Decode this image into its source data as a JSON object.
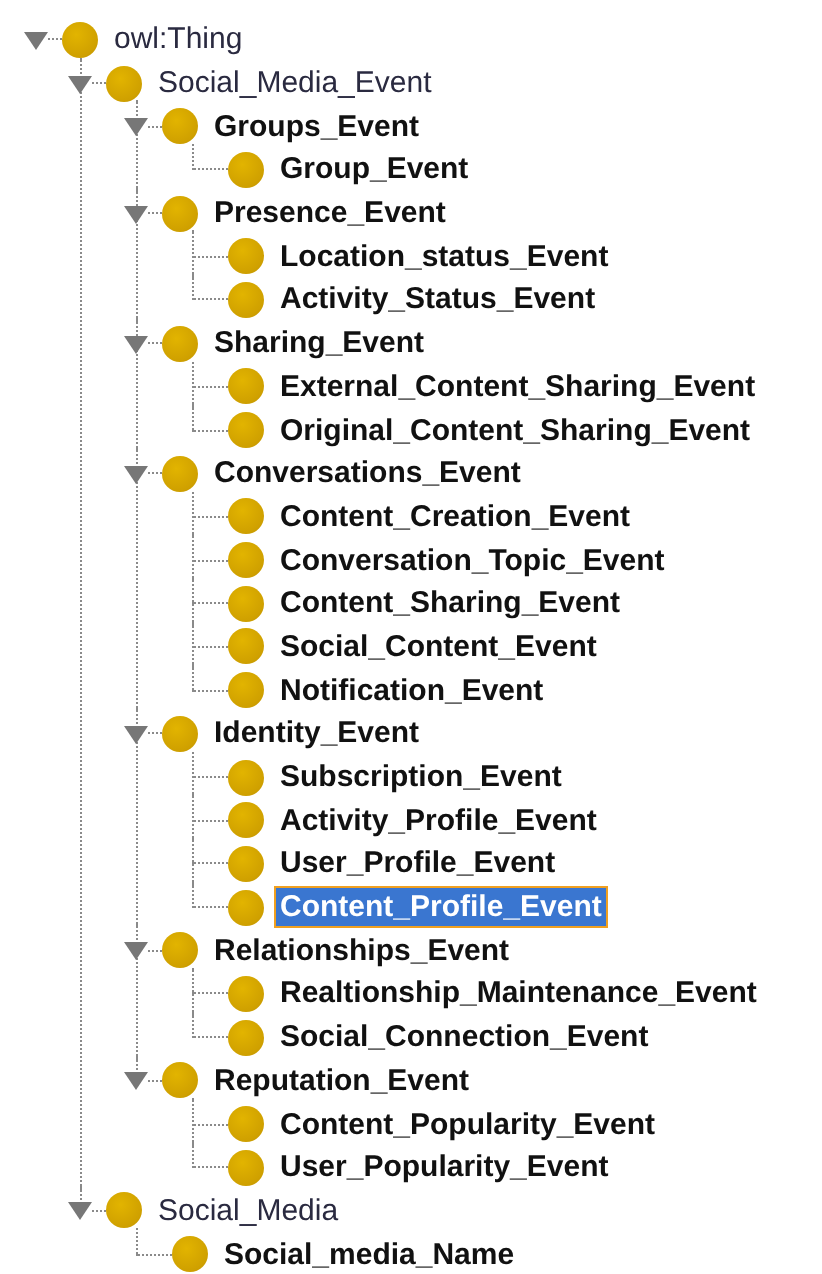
{
  "tree": [
    {
      "label": "owl:Thing",
      "bold": false,
      "selected": false,
      "expanded": true,
      "children": [
        {
          "label": "Social_Media_Event",
          "bold": false,
          "selected": false,
          "expanded": true,
          "children": [
            {
              "label": "Groups_Event",
              "bold": true,
              "selected": false,
              "expanded": true,
              "children": [
                {
                  "label": "Group_Event",
                  "bold": true,
                  "selected": false
                }
              ]
            },
            {
              "label": "Presence_Event",
              "bold": true,
              "selected": false,
              "expanded": true,
              "children": [
                {
                  "label": "Location_status_Event",
                  "bold": true,
                  "selected": false
                },
                {
                  "label": "Activity_Status_Event",
                  "bold": true,
                  "selected": false
                }
              ]
            },
            {
              "label": "Sharing_Event",
              "bold": true,
              "selected": false,
              "expanded": true,
              "children": [
                {
                  "label": "External_Content_Sharing_Event",
                  "bold": true,
                  "selected": false
                },
                {
                  "label": "Original_Content_Sharing_Event",
                  "bold": true,
                  "selected": false
                }
              ]
            },
            {
              "label": "Conversations_Event",
              "bold": true,
              "selected": false,
              "expanded": true,
              "children": [
                {
                  "label": "Content_Creation_Event",
                  "bold": true,
                  "selected": false
                },
                {
                  "label": "Conversation_Topic_Event",
                  "bold": true,
                  "selected": false
                },
                {
                  "label": "Content_Sharing_Event",
                  "bold": true,
                  "selected": false
                },
                {
                  "label": "Social_Content_Event",
                  "bold": true,
                  "selected": false
                },
                {
                  "label": "Notification_Event",
                  "bold": true,
                  "selected": false
                }
              ]
            },
            {
              "label": "Identity_Event",
              "bold": true,
              "selected": false,
              "expanded": true,
              "children": [
                {
                  "label": "Subscription_Event",
                  "bold": true,
                  "selected": false
                },
                {
                  "label": "Activity_Profile_Event",
                  "bold": true,
                  "selected": false
                },
                {
                  "label": "User_Profile_Event",
                  "bold": true,
                  "selected": false
                },
                {
                  "label": "Content_Profile_Event",
                  "bold": true,
                  "selected": true
                }
              ]
            },
            {
              "label": "Relationships_Event",
              "bold": true,
              "selected": false,
              "expanded": true,
              "children": [
                {
                  "label": "Realtionship_Maintenance_Event",
                  "bold": true,
                  "selected": false
                },
                {
                  "label": "Social_Connection_Event",
                  "bold": true,
                  "selected": false
                }
              ]
            },
            {
              "label": "Reputation_Event",
              "bold": true,
              "selected": false,
              "expanded": true,
              "children": [
                {
                  "label": "Content_Popularity_Event",
                  "bold": true,
                  "selected": false
                },
                {
                  "label": "User_Popularity_Event",
                  "bold": true,
                  "selected": false
                }
              ]
            }
          ]
        },
        {
          "label": "Social_Media",
          "bold": false,
          "selected": false,
          "expanded": true,
          "children": [
            {
              "label": "Social_media_Name",
              "bold": true,
              "selected": false
            }
          ]
        }
      ]
    }
  ]
}
